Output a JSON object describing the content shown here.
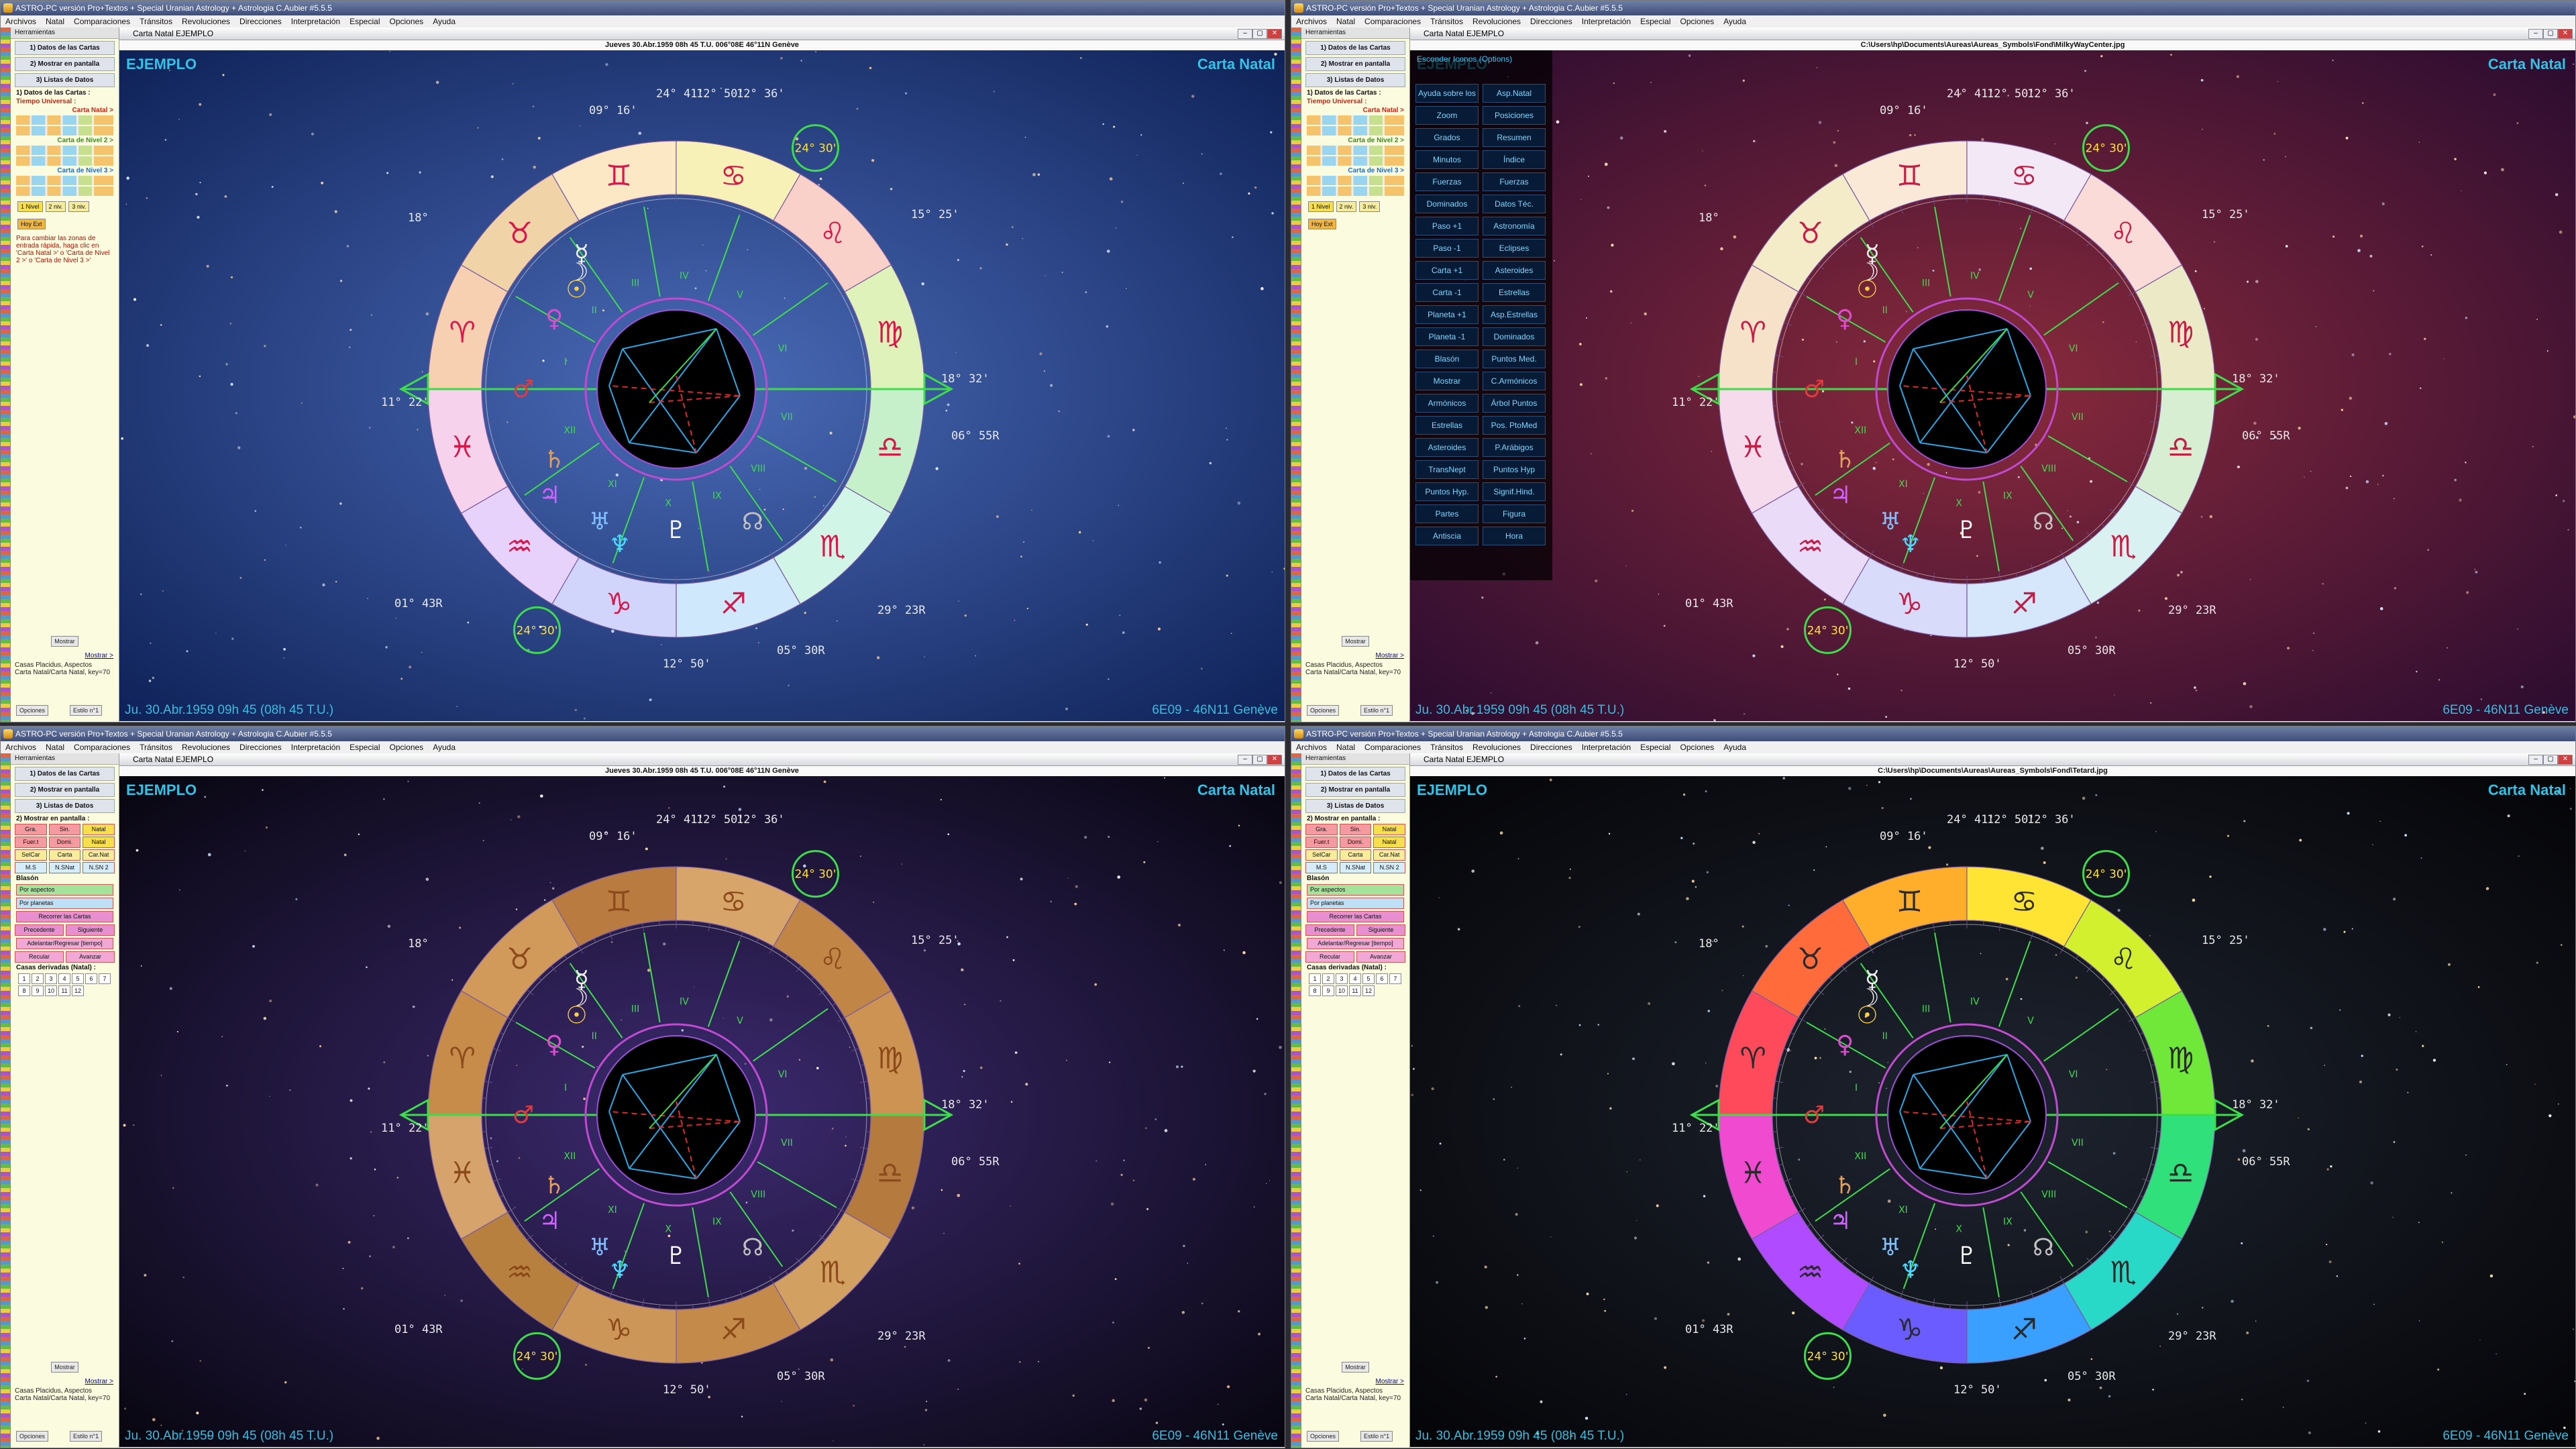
{
  "app_title": "ASTRO-PC versión Pro+Textos + Special Uranian Astrology + Astrologia C.Aubier #5.5.5",
  "menu": [
    "Archivos",
    "Natal",
    "Comparaciones",
    "Tránsitos",
    "Revoluciones",
    "Direcciones",
    "Interpretación",
    "Especial",
    "Opciones",
    "Ayuda"
  ],
  "tools_title": "Herramientas",
  "tools_main": [
    "1) Datos de las Cartas",
    "2) Mostrar en pantalla",
    "3) Listas de Datos"
  ],
  "tools_tl": {
    "datos_label": "1) Datos de las Cartas :",
    "tiempo": "Tiempo Universal :",
    "natal": "Carta Natal >",
    "nivel2": "Carta de Nivel 2 >",
    "nivel3": "Carta de Nivel 3 >",
    "tabs": [
      "1 Nivel",
      "2 niv.",
      "3 niv."
    ],
    "hoy": "Hoy Ext",
    "note": "Para cambiar las zonas de entrada rápida, haga clic en 'Carta Natal >' o 'Carta de Nivel 2 >' o 'Carta de Nivel 3 >'"
  },
  "tools_bl": {
    "mostrar_label": "2) Mostrar en pantalla :",
    "row1": [
      "Gra.",
      "Sin.",
      "Natal"
    ],
    "row2": [
      "Fuer.t",
      "Domi.",
      "Natal"
    ],
    "row3": [
      "SelCar",
      "Carta",
      "Car.Nat"
    ],
    "row4": [
      "M.S",
      "N.SNat",
      "N.SN 2"
    ],
    "blason": "Blasón",
    "por_aspectos": "Por aspectos",
    "por_planetas": "Por planetas",
    "recorrer": "Recorrer las Cartas",
    "precedente": "Precedente",
    "siguiente": "Siguiente",
    "adelantar": "Adelantar/Regresar [tiempo]",
    "retroceder": "Recular",
    "avanzar": "Avanzar",
    "casas_derivadas": "Casas derivadas (Natal) :",
    "nums": [
      "1",
      "2",
      "3",
      "4",
      "5",
      "6",
      "7",
      "8",
      "9",
      "10",
      "11",
      "12"
    ]
  },
  "tools_bottom": {
    "mostrar_btn": "Mostrar",
    "mostrar_link": "Mostrar >",
    "casas": "Casas Placidus, Aspectos",
    "carta_nat": "Carta Natal/Carta Natal, key=70",
    "opciones": "Opciones",
    "estilo": "Estilo n°1"
  },
  "chart_window_title": "Carta Natal  EJEMPLO",
  "headers": {
    "date": "Jueves 30.Abr.1959 08h 45 T.U. 006°08E 46°11N  Genève",
    "path_tr": "C:\\Users\\hp\\Documents\\Aureas\\Aureas_Symbols\\Fond\\MilkyWayCenter.jpg",
    "path_br": "C:\\Users\\hp\\Documents\\Aureas\\Aureas_Symbols\\Fond\\Tetard.jpg"
  },
  "overlay": {
    "ejemplo": "EJEMPLO",
    "carta_natal": "Carta Natal",
    "date_footer": "Ju. 30.Abr.1959 09h 45 (08h 45 T.U.)",
    "place_footer": "6E09 - 46N11  Genève"
  },
  "degrees": {
    "sun": "24° 30'",
    "asc": "18° 32'",
    "mc": "24° 30'",
    "ic_a": "12° 50'",
    "ic_b": "05° 30R",
    "top_a": "24° 41'",
    "top_b": "12° 50'",
    "top_c": "12° 36'",
    "top_d": "09° 16'",
    "left_a": "18°",
    "right_a": "06° 55R",
    "right_b": "29° 23R",
    "left_b": "01° 43R",
    "left_c": "15° 25'",
    "left_d": "11° 22'"
  },
  "help_panel": {
    "title": "Esconder Iconos (Options)",
    "left": [
      "Ayuda sobre los botones",
      "Zoom",
      "Grados",
      "Minutos",
      "Fuerzas",
      "Dominados",
      "Paso +1",
      "Paso -1",
      "Carta +1",
      "Carta -1",
      "Planeta +1",
      "Planeta -1",
      "Blasón",
      "Mostrar",
      "Armónicos",
      "Estrellas",
      "Asteroides",
      "TransNept",
      "Puntos Hyp.",
      "Partes",
      "Antiscia"
    ],
    "right": [
      "Asp.Natal",
      "Posiciones",
      "Resumen",
      "Índice",
      "Fuerzas",
      "Datos Téc.",
      "Astronomía",
      "Eclipses",
      "Asteroides",
      "Estrellas",
      "Asp.Estrellas",
      "Dominados",
      "Puntos Med.",
      "C.Armónicos",
      "Árbol Puntos Med.",
      "Pos. PtoMed",
      "P.Arábigos",
      "Puntos Hyp",
      "Signif.Hind.",
      "Figura",
      "Hora"
    ]
  },
  "zodiac": [
    "♈",
    "♉",
    "♊",
    "♋",
    "♌",
    "♍",
    "♎",
    "♏",
    "♐",
    "♑",
    "♒",
    "♓"
  ],
  "planets": [
    "☉",
    "☽",
    "☿",
    "♀",
    "♂",
    "♃",
    "♄",
    "♅",
    "♆",
    "♇",
    "☊"
  ],
  "houses": [
    "I",
    "II",
    "III",
    "IV",
    "V",
    "VI",
    "VII",
    "VIII",
    "IX",
    "X",
    "XI",
    "XII"
  ],
  "themes": {
    "tl": {
      "bg1": "#0f2258",
      "bg2": "#4a6bb8",
      "ring": [
        "#f7d0b1",
        "#f1d3a8",
        "#fde8c6",
        "#f7f0b7",
        "#f9d1c9",
        "#dff2b9",
        "#c6f0c9",
        "#d1f5e6",
        "#cfe8fb",
        "#d1d4fb",
        "#e7d2fb",
        "#f7d2ec"
      ],
      "glyph": "#d8174b"
    },
    "tr": {
      "bg1": "#2b0c30",
      "bg2": "#8a2a3c",
      "ring": [
        "#f6e1c9",
        "#f4ecc9",
        "#fbe9d8",
        "#f2e8f6",
        "#fadbd7",
        "#ebe9c6",
        "#d8eed3",
        "#d9f1f0",
        "#d6e7fb",
        "#d8dbfa",
        "#eadcf8",
        "#f5dbeb"
      ],
      "glyph": "#c41d46"
    },
    "bl": {
      "bg1": "#080610",
      "bg2": "#3c2a70",
      "ring": [
        "#c78b4a",
        "#d19a5a",
        "#b97b3f",
        "#d7a46a",
        "#c18646",
        "#cc9353",
        "#b47a3e",
        "#d2a061",
        "#c38a49",
        "#cc9658",
        "#b8803f",
        "#d6a36d"
      ],
      "glyph": "#8c4a1a"
    },
    "br": {
      "bg1": "#050508",
      "bg2": "#1e2430",
      "ring": [
        "#ff4a5c",
        "#ff6b3a",
        "#ffae2c",
        "#ffe433",
        "#d2f02e",
        "#6fe83a",
        "#30e07a",
        "#27d9c6",
        "#3aa0ff",
        "#6a5cff",
        "#b04bff",
        "#f04bd0"
      ],
      "glyph": "#2a2a2a"
    }
  },
  "nums_bl": [
    "1",
    "2",
    "3",
    "4",
    "5",
    "6",
    "7",
    "8",
    "9",
    "10",
    "11",
    "12"
  ]
}
